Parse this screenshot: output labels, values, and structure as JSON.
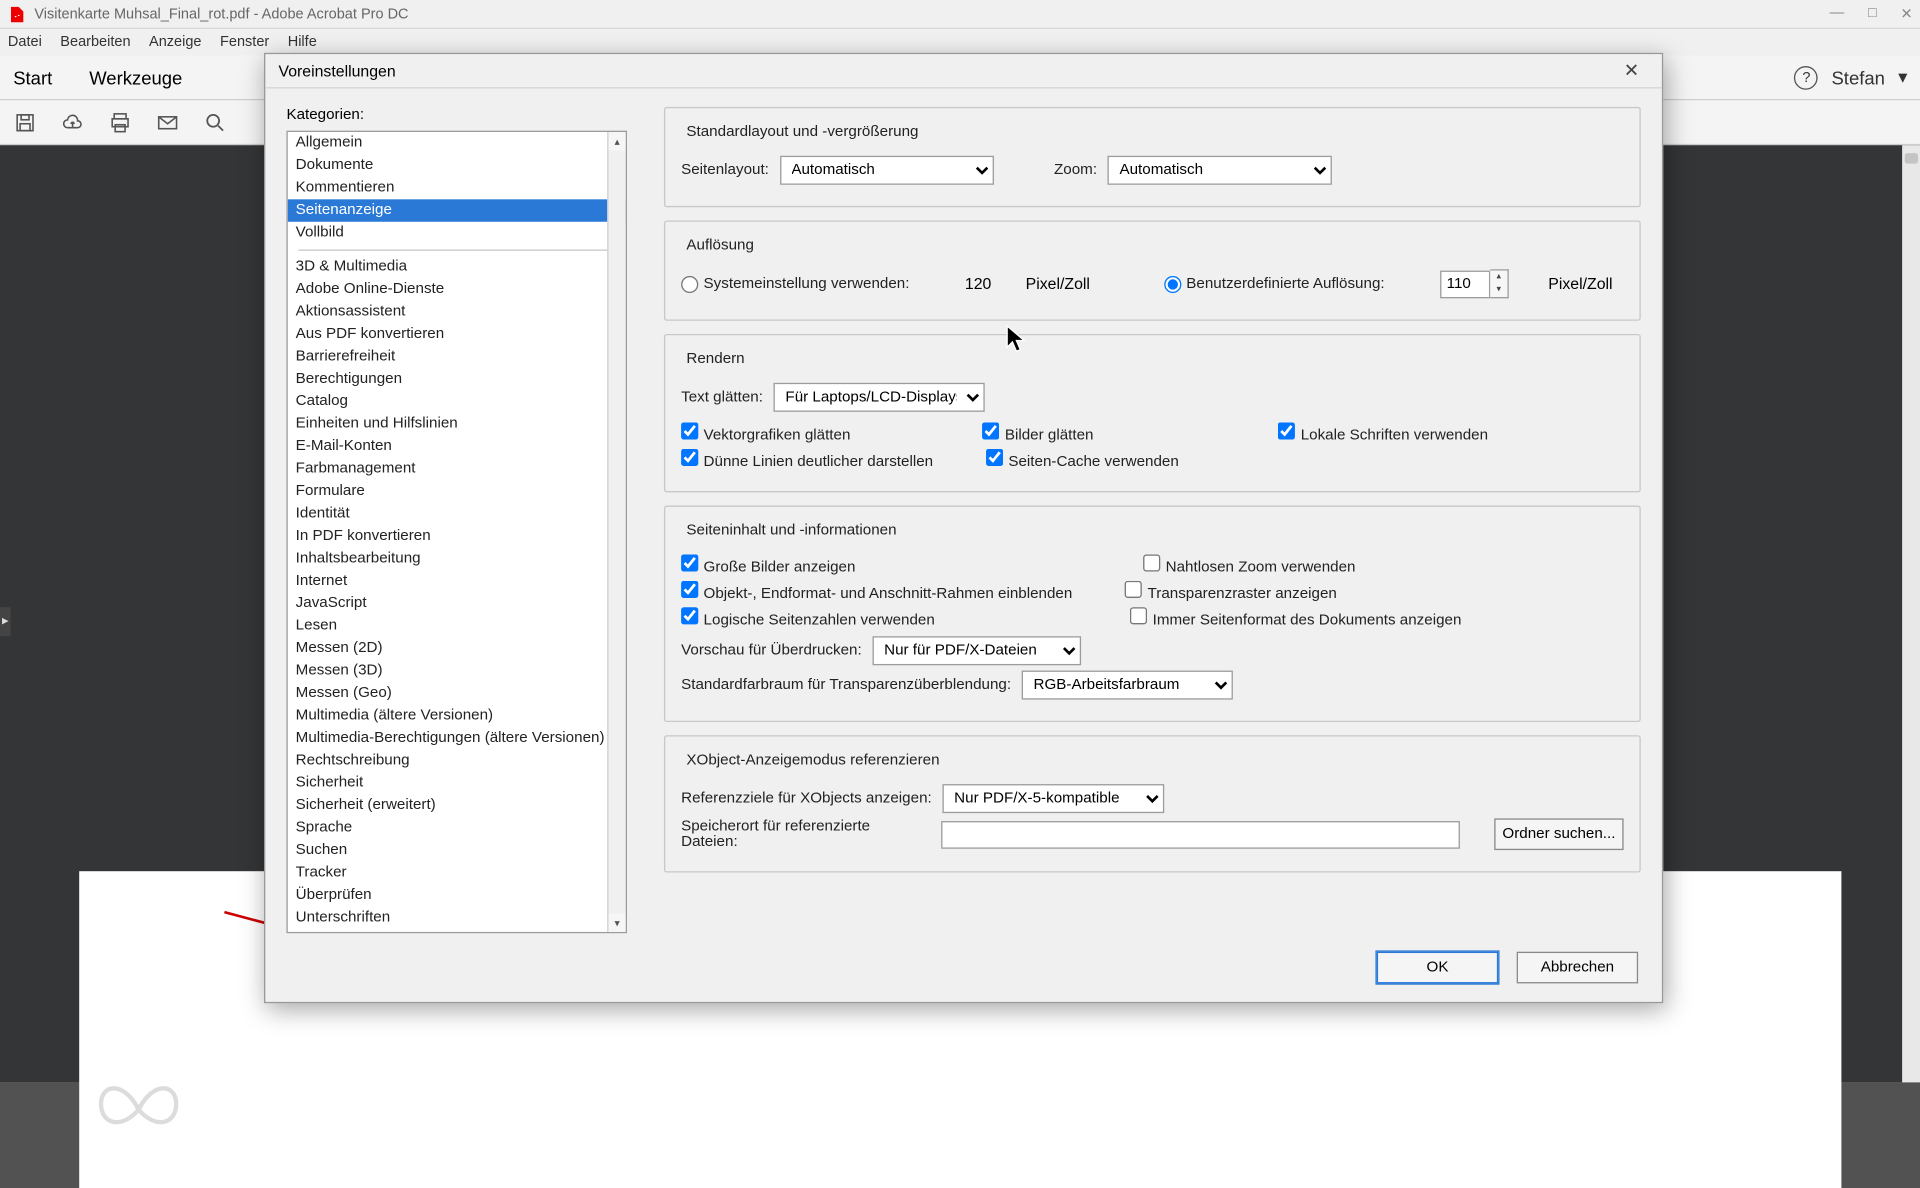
{
  "title": "Visitenkarte Muhsal_Final_rot.pdf - Adobe Acrobat Pro DC",
  "menu": [
    "Datei",
    "Bearbeiten",
    "Anzeige",
    "Fenster",
    "Hilfe"
  ],
  "tabs": {
    "start": "Start",
    "werkzeuge": "Werkzeuge"
  },
  "user": {
    "name": "Stefan"
  },
  "dialog": {
    "title": "Voreinstellungen",
    "categories_label": "Kategorien:",
    "categories_top": [
      "Allgemein",
      "Dokumente",
      "Kommentieren",
      "Seitenanzeige",
      "Vollbild"
    ],
    "categories": [
      "3D & Multimedia",
      "Adobe Online-Dienste",
      "Aktionsassistent",
      "Aus PDF konvertieren",
      "Barrierefreiheit",
      "Berechtigungen",
      "Catalog",
      "Einheiten und Hilfslinien",
      "E-Mail-Konten",
      "Farbmanagement",
      "Formulare",
      "Identität",
      "In PDF konvertieren",
      "Inhaltsbearbeitung",
      "Internet",
      "JavaScript",
      "Lesen",
      "Messen (2D)",
      "Messen (3D)",
      "Messen (Geo)",
      "Multimedia (ältere Versionen)",
      "Multimedia-Berechtigungen (ältere Versionen)",
      "Rechtschreibung",
      "Sicherheit",
      "Sicherheit (erweitert)",
      "Sprache",
      "Suchen",
      "Tracker",
      "Überprüfen",
      "Unterschriften"
    ],
    "selected_category": "Seitenanzeige",
    "layout": {
      "legend": "Standardlayout und -vergrößerung",
      "seitenlayout_label": "Seitenlayout:",
      "seitenlayout_value": "Automatisch",
      "zoom_label": "Zoom:",
      "zoom_value": "Automatisch"
    },
    "resolution": {
      "legend": "Auflösung",
      "system_label": "Systemeinstellung verwenden:",
      "system_value": "120",
      "pixel_unit": "Pixel/Zoll",
      "custom_label": "Benutzerdefinierte Auflösung:",
      "custom_value": "110"
    },
    "render": {
      "legend": "Rendern",
      "text_glatt_label": "Text glätten:",
      "text_glatt_value": "Für Laptops/LCD-Displays",
      "vektor": "Vektorgrafiken glätten",
      "bilder": "Bilder glätten",
      "lokale": "Lokale Schriften verwenden",
      "duenne": "Dünne Linien deutlicher darstellen",
      "cache": "Seiten-Cache verwenden"
    },
    "pagecontent": {
      "legend": "Seiteninhalt und -informationen",
      "grosse": "Große Bilder anzeigen",
      "nahtlos": "Nahtlosen Zoom verwenden",
      "objekt": "Objekt-, Endformat- und Anschnitt-Rahmen einblenden",
      "transparenz": "Transparenzraster anzeigen",
      "logische": "Logische Seitenzahlen verwenden",
      "immer": "Immer Seitenformat des Dokuments anzeigen",
      "vorschau_label": "Vorschau für Überdrucken:",
      "vorschau_value": "Nur für PDF/X-Dateien",
      "farbraum_label": "Standardfarbraum für Transparenzüberblendung:",
      "farbraum_value": "RGB-Arbeitsfarbraum"
    },
    "xobject": {
      "legend": "XObject-Anzeigemodus referenzieren",
      "referenz_label": "Referenzziele für XObjects anzeigen:",
      "referenz_value": "Nur PDF/X-5-kompatible",
      "speicherort_label": "Speicherort für referenzierte Dateien:",
      "speicherort_value": "",
      "ordner_btn": "Ordner suchen..."
    },
    "ok": "OK",
    "cancel": "Abbrechen"
  }
}
